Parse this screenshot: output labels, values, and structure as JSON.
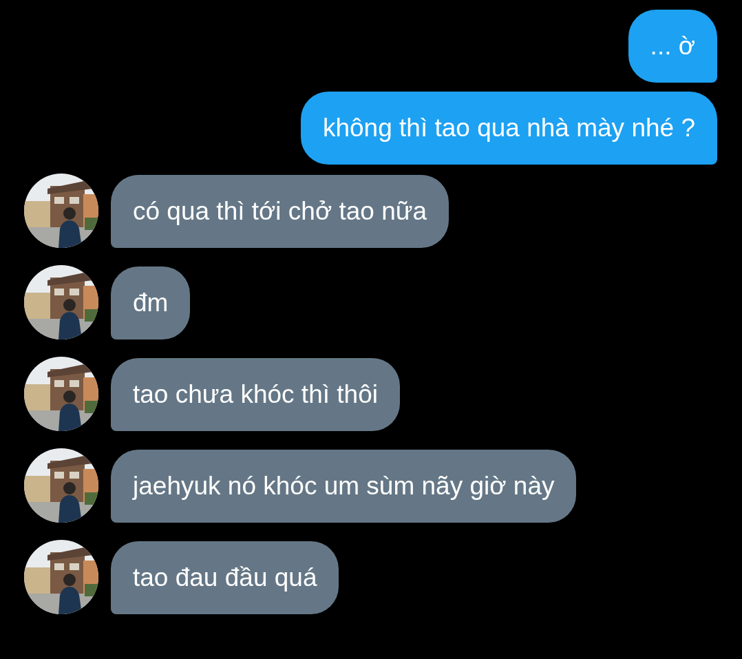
{
  "messages": [
    {
      "kind": "sent",
      "text": "... ờ"
    },
    {
      "kind": "sent",
      "text": "không thì tao qua nhà mày nhé ?"
    },
    {
      "kind": "received",
      "text": "có qua thì tới chở tao nữa"
    },
    {
      "kind": "received",
      "text": "đm"
    },
    {
      "kind": "received",
      "text": "tao chưa khóc thì thôi"
    },
    {
      "kind": "received",
      "text": "jaehyuk nó khóc um sùm nãy giờ này"
    },
    {
      "kind": "received",
      "text": "tao đau đầu quá"
    }
  ]
}
